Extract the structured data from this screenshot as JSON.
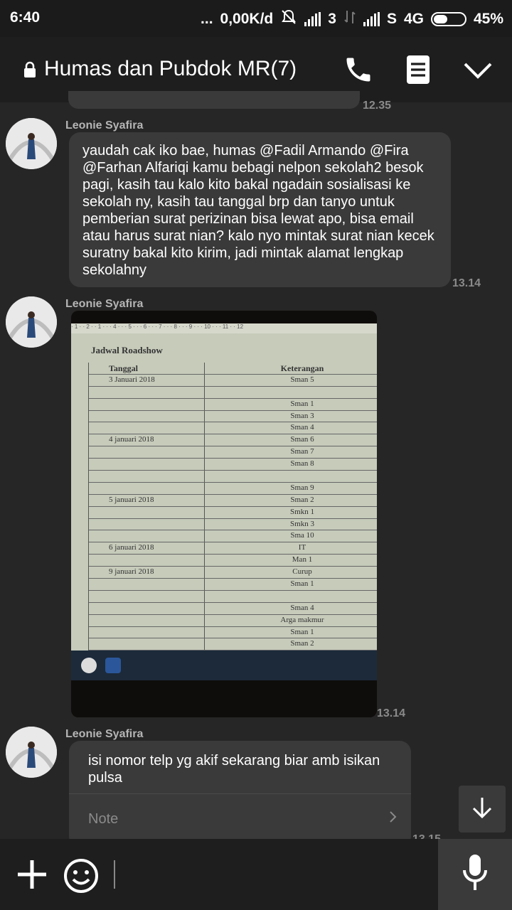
{
  "status_bar": {
    "time": "6:40",
    "dots": "...",
    "network_speed": "0,00K/d",
    "sim1": "3",
    "sim2": "S",
    "network_type": "4G",
    "battery": "45%",
    "battery_level": 0.45
  },
  "header": {
    "title": "Humas dan Pubdok MR(7)",
    "icons": [
      "lock-icon",
      "phone-icon",
      "notes-icon",
      "chevron-down-icon"
    ]
  },
  "messages": [
    {
      "type": "prev",
      "time": "12.35"
    },
    {
      "type": "text",
      "sender": "Leonie Syafira",
      "text": "yaudah cak iko bae, humas @Fadil Armando @Fira @Farhan Alfariqi kamu bebagi nelpon sekolah2 besok pagi, kasih tau kalo kito bakal ngadain sosialisasi ke sekolah ny, kasih tau tanggal brp dan tanyo untuk pemberian surat perizinan bisa lewat apo, bisa email atau harus surat nian? kalo nyo mintak surat nian kecek suratny bakal kito kirim, jadi mintak alamat lengkap sekolahny",
      "time": "13.14"
    },
    {
      "type": "image",
      "sender": "Leonie Syafira",
      "time": "13.14",
      "image_content": {
        "ruler": "· 1 · · 2 · · 1 · · · 4 · · · 5 · · · 6 · · · 7 · · · 8 · · · 9 · · · 10 · · · 11 · · 12",
        "title": "Jadwal Roadshow",
        "headers": [
          "Tanggal",
          "Keterangan"
        ],
        "rows": [
          [
            "3 Januari 2018",
            "Sman 5"
          ],
          [
            "",
            ""
          ],
          [
            "",
            "Sman 1"
          ],
          [
            "",
            "Sman 3"
          ],
          [
            "",
            "Sman 4"
          ],
          [
            "4 januari 2018",
            "Sman 6"
          ],
          [
            "",
            "Sman 7"
          ],
          [
            "",
            "Sman 8"
          ],
          [
            "",
            ""
          ],
          [
            "",
            "Sman 9"
          ],
          [
            "5 januari 2018",
            "Sman 2"
          ],
          [
            "",
            "Smkn 1"
          ],
          [
            "",
            "Smkn 3"
          ],
          [
            "",
            "Sma 10"
          ],
          [
            "6 januari 2018",
            "IT"
          ],
          [
            "",
            "Man 1"
          ],
          [
            "9 januari 2018",
            "Curup"
          ],
          [
            "",
            "Sman 1"
          ],
          [
            "",
            ""
          ],
          [
            "",
            "Sman 4"
          ],
          [
            "",
            "Arga makmur"
          ],
          [
            "",
            "Sman 1"
          ],
          [
            "",
            "Sman 2"
          ]
        ]
      }
    },
    {
      "type": "note",
      "sender": "Leonie Syafira",
      "text": "isi nomor telp yg akif sekarang biar amb isikan pulsa",
      "note_label": "Note",
      "time": "13.15"
    }
  ],
  "bottom_bar": {
    "icons": [
      "plus-icon",
      "emoji-icon",
      "microphone-icon"
    ],
    "input_value": ""
  },
  "colors": {
    "background": "#262626",
    "bubble": "#3a3a3a",
    "header": "#1e1e1e"
  }
}
